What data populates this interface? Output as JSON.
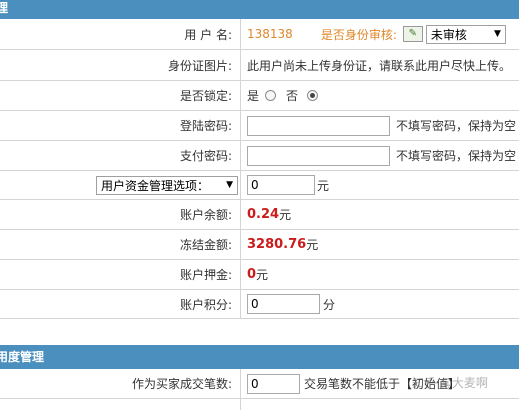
{
  "header_top": {
    "title": "理"
  },
  "rows": {
    "username": {
      "label": "用 户 名:",
      "value": "138138",
      "audit_label": "是否身份审核:",
      "audit_value": "未审核"
    },
    "idcard": {
      "label": "身份证图片:",
      "text": "此用户尚未上传身份证，请联系此用户尽快上传。"
    },
    "locked": {
      "label": "是否锁定:",
      "yes": "是",
      "no": "否"
    },
    "login_pwd": {
      "label": "登陆密码:",
      "value": "",
      "hint": "不填写密码，保持为空"
    },
    "pay_pwd": {
      "label": "支付密码:",
      "value": "",
      "hint": "不填写密码，保持为空"
    },
    "funds": {
      "select_label": "用户资金管理选项：",
      "value": "0",
      "unit": "元"
    },
    "balance": {
      "label": "账户余额:",
      "value": "0.24",
      "unit": "元"
    },
    "frozen": {
      "label": "冻结金额:",
      "value": "3280.76",
      "unit": "元"
    },
    "deposit": {
      "label": "账户押金:",
      "value": "0",
      "unit": "元"
    },
    "points": {
      "label": "账户积分:",
      "value": "0",
      "unit": "分"
    }
  },
  "header_bottom": {
    "title": "用度管理"
  },
  "buyer": {
    "label": "作为买家成交笔数:",
    "value": "0",
    "hint": "交易笔数不能低于【初始值】"
  },
  "watermark": "知乎 @大麦啊"
}
